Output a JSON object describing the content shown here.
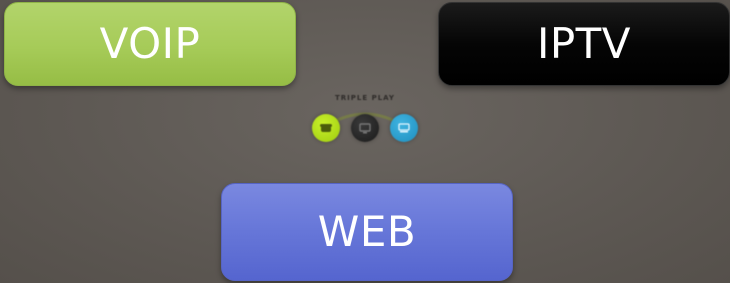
{
  "tiles": {
    "voip": {
      "label": "VOIP",
      "color": "#a6cb58"
    },
    "iptv": {
      "label": "IPTV",
      "color": "#000000"
    },
    "web": {
      "label": "WEB",
      "color": "#6676d8"
    }
  },
  "logo": {
    "text": "TRIPLE PLAY",
    "icons": [
      "phone-icon",
      "tv-icon",
      "monitor-icon"
    ],
    "colors": [
      "#b4e01e",
      "#222222",
      "#2fa2d2"
    ]
  },
  "background_color": "#5f5a55"
}
